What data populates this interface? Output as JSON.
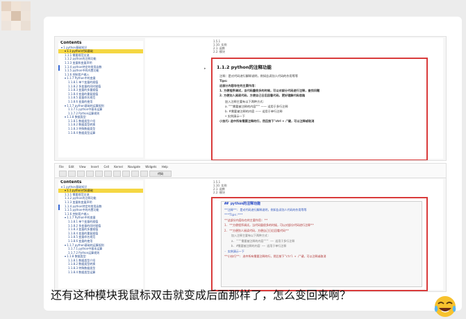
{
  "post": {
    "caption": "还有这种模块我鼠标双击就变成后面那样了，怎么变回来啊？",
    "emoji": "crying-laughing-face"
  },
  "toc": {
    "title": "Contents",
    "items": [
      "▾ 1 python基础知识",
      "▾ 1.1 python代码基础",
      "1.1.1 需要规范交流",
      "1.1.2 python的注释功能",
      "1.1.3 变量和变量声明",
      "1.1.4 python特定的常用函数",
      "1.1.5 python中的内置功能",
      "1.1.6 控制用户输入",
      "▾ 1.1.7 Python中的变量",
      "1.1.8.1 单个变量的赋值",
      "1.1.8.2 多变量的同时赋值",
      "1.1.8.3 变量的多重赋值",
      "1.1.8.4 变量的重复赋值",
      "1.1.8.5 变量命名规范",
      "1.1.8.6 变量的使用",
      "▾ 1.1.7 python基础的运算规则",
      "1.1.7.1 python中基本运算",
      "1.1.7.2 Python运算规则",
      "▾ 1.1.8 数据类型",
      "1.1.8.1 数据类型介绍",
      "1.1.8.2 数据类型转换",
      "1.1.8.3 特殊数据类型",
      "1.1.8.4 数据类型运算"
    ]
  },
  "notebook": {
    "top_list": [
      "1.5.1",
      "1.10. 实例",
      "2.1. 函数",
      "2.2. 模块"
    ],
    "rendered": {
      "heading": "1.1.2  python的注释功能",
      "lines": [
        "注释：是对代码进行解释说明，例如告诉别人代码的作用等等",
        "Tips:",
        "这部分内容存在的主要作用：",
        "1. 方便程序调试，当代码量很多的时候，可以对部分代码进行注释，查找问题",
        "2. 方便别人阅读代码，方便自己日后回看代码，更好理解代码思路",
        "加入注释主要有以下两种方式:",
        "a. \"\"\"需要被注释的内容\"\"\" —— 适用于多行注释",
        "b. #需要被注释的内容 —— 适用于单行注释",
        "• 实例演示一下",
        "小技巧: 选中所有需要注释的行，然后按下\"ctrl + /\"键，可以注释或取消"
      ]
    },
    "raw": {
      "lines": [
        "## python的注释功能",
        "**注释**: 是对代码进行解释说明，例如告诉别人代码的作用等等",
        "***Tips:***",
        "**这部分内容存在的主要作用: **",
        "1. **方便程序调试，当代码量很多的时候，可以对部分代码进行注释**",
        "2. **方便别人阅读代码，方便自己日后回看代码**",
        "加入注释主要有以下两种方式:",
        "a. \"\"\"需要被注释的内容\"\"\" —— 适用于多行注释",
        "b. #需要被注释的内容 —— 适用于单行注释",
        "- 实例演示一下",
        "**小技巧**: 选中所有需要注释的行，然后按下\"ctrl + /\"键，可以注释或取消"
      ]
    }
  },
  "toolbar": {
    "menu": "File Edit View Insert Cell Kernel Navigate Widgets Help",
    "cell_type": "代码"
  }
}
